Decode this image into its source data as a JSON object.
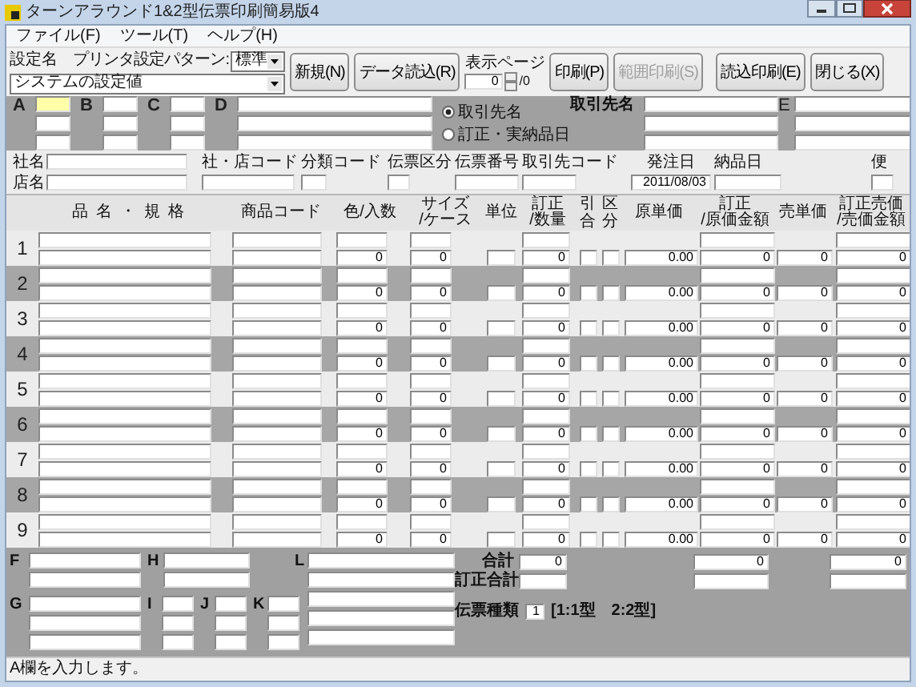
{
  "window": {
    "title": "ターンアラウンド1&2型伝票印刷簡易版4"
  },
  "menu": [
    "ファイル(F)",
    "ツール(T)",
    "ヘルプ(H)"
  ],
  "toolbar": {
    "setting_label": "設定名",
    "pattern_label": "プリンタ設定パターン:",
    "pattern_value": "標準",
    "setting_value": "システムの設定値",
    "buttons": [
      {
        "label": "新規(N)",
        "disabled": false
      },
      {
        "label": "データ読込(R)",
        "disabled": false
      },
      {
        "label": "印刷(P)",
        "disabled": false
      },
      {
        "label": "範囲印刷(S)",
        "disabled": true
      },
      {
        "label": "読込印刷(E)",
        "disabled": false
      },
      {
        "label": "閉じる(X)",
        "disabled": false
      }
    ],
    "page": {
      "label": "表示ページ",
      "value": "0",
      "total": "/0"
    }
  },
  "codes": [
    {
      "label": "A",
      "focused": true
    },
    {
      "label": "B",
      "focused": false
    },
    {
      "label": "C",
      "focused": false
    },
    {
      "label": "D",
      "focused": false
    }
  ],
  "name_mode": [
    {
      "label": "取引先名",
      "selected": true
    },
    {
      "label": "訂正・実納品日",
      "selected": false
    }
  ],
  "partner_label": "取引先名",
  "e_label": "E",
  "info": {
    "company_label": "社名",
    "store_label": "店名",
    "code_label": "社・店コード",
    "category_label": "分類コード",
    "slip_type_label": "伝票区分",
    "slip_no_label": "伝票番号",
    "partner_code_label": "取引先コード",
    "order_date_label": "発注日",
    "order_date": "2011/08/03",
    "delivery_date_label": "納品日",
    "flight_label": "便"
  },
  "columns": [
    {
      "kind": "plain",
      "text": "品名・規格"
    },
    {
      "kind": "plain",
      "text": "商品コード"
    },
    {
      "kind": "plain",
      "text": "色/入数"
    },
    {
      "kind": "stacked",
      "lines": [
        "サイズ",
        "/ケース"
      ]
    },
    {
      "kind": "plain",
      "text": "単位"
    },
    {
      "kind": "stacked",
      "lines": [
        "訂正",
        "/数量"
      ]
    },
    {
      "kind": "vertical",
      "text": "引合"
    },
    {
      "kind": "vertical",
      "text": "区分"
    },
    {
      "kind": "plain",
      "text": "原単価"
    },
    {
      "kind": "stacked",
      "lines": [
        "訂正",
        "/原価金額"
      ]
    },
    {
      "kind": "plain",
      "text": "売単価"
    },
    {
      "kind": "stacked",
      "lines": [
        "訂正売価",
        "/売価金額"
      ]
    }
  ],
  "rows": [
    {
      "no": "1",
      "color_qty": "0",
      "size_case": "0",
      "qty": "0",
      "cost_price": "0.00",
      "cost_amount": "0",
      "sell_price": "0",
      "sell_amount": "0"
    },
    {
      "no": "2",
      "color_qty": "0",
      "size_case": "0",
      "qty": "0",
      "cost_price": "0.00",
      "cost_amount": "0",
      "sell_price": "0",
      "sell_amount": "0"
    },
    {
      "no": "3",
      "color_qty": "0",
      "size_case": "0",
      "qty": "0",
      "cost_price": "0.00",
      "cost_amount": "0",
      "sell_price": "0",
      "sell_amount": "0"
    },
    {
      "no": "4",
      "color_qty": "0",
      "size_case": "0",
      "qty": "0",
      "cost_price": "0.00",
      "cost_amount": "0",
      "sell_price": "0",
      "sell_amount": "0"
    },
    {
      "no": "5",
      "color_qty": "0",
      "size_case": "0",
      "qty": "0",
      "cost_price": "0.00",
      "cost_amount": "0",
      "sell_price": "0",
      "sell_amount": "0"
    },
    {
      "no": "6",
      "color_qty": "0",
      "size_case": "0",
      "qty": "0",
      "cost_price": "0.00",
      "cost_amount": "0",
      "sell_price": "0",
      "sell_amount": "0"
    },
    {
      "no": "7",
      "color_qty": "0",
      "size_case": "0",
      "qty": "0",
      "cost_price": "0.00",
      "cost_amount": "0",
      "sell_price": "0",
      "sell_amount": "0"
    },
    {
      "no": "8",
      "color_qty": "0",
      "size_case": "0",
      "qty": "0",
      "cost_price": "0.00",
      "cost_amount": "0",
      "sell_price": "0",
      "sell_amount": "0"
    },
    {
      "no": "9",
      "color_qty": "0",
      "size_case": "0",
      "qty": "0",
      "cost_price": "0.00",
      "cost_amount": "0",
      "sell_price": "0",
      "sell_amount": "0"
    }
  ],
  "bottom": {
    "f_label": "F",
    "g_label": "G",
    "h_label": "H",
    "i_label": "I",
    "j_label": "J",
    "k_label": "K",
    "l_label": "L",
    "total_label": "合計",
    "totals": [
      "0",
      "0",
      "0"
    ],
    "corrected_total_label": "訂正合計",
    "slip_kind_label": "伝票種類",
    "slip_kind": "1",
    "slip_kind_hint": "[1:1型　2:2型]"
  },
  "status_bar": "A欄を入力します。"
}
